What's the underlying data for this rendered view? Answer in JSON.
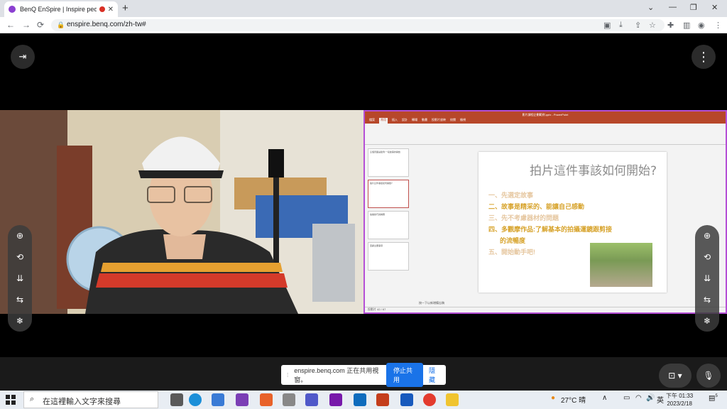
{
  "browser": {
    "tab_title": "BenQ EnSpire | Inspire peo",
    "tab_close": "✕",
    "new_tab": "+",
    "url": "enspire.benq.com/zh-tw#",
    "back": "←",
    "forward": "→",
    "reload": "⟳"
  },
  "meeting": {
    "exit_label": "⇥",
    "more_label": "⋮"
  },
  "ppt": {
    "window_title": "影片課程企劃範例.pptx - PowerPoint",
    "tabs": [
      "檔案",
      "常用",
      "插入",
      "設計",
      "轉場",
      "動畫",
      "投影片放映",
      "校閱",
      "檢視"
    ],
    "active_tab": "常用",
    "thumb1": "這個頁面是範例:一段故事的開始",
    "thumb2": "拍片這件事該如何開始?",
    "thumb3": "拍攝技巧與構圖",
    "thumb4": "回顧主要事項",
    "slide_title": "拍片這件事該如何開始?",
    "items": [
      "一、先選定故事",
      "二、故事是精采的、能讓自己感動",
      "三、先不考慮器材的問題",
      "四、多觀摩作品:了解基本的拍攝運鏡跟剪接",
      "的流暢度",
      "五、開始動手吧!"
    ],
    "notes": "按一下以新增備忘稿",
    "status": "投影片 42 / 67"
  },
  "share_notice": {
    "text": "enspire.benq.com 正在共用視窗。",
    "stop_label": "停止共用",
    "hide_label": "隱藏"
  },
  "taskbar": {
    "search_placeholder": "在這裡輸入文字來搜尋",
    "weather": "27°C 晴",
    "ime": "英",
    "time": "下午 01:33",
    "date": "2023/2/18",
    "notification_count": "5"
  },
  "colors": {
    "accent": "#1a73e8",
    "ppt_red": "#b7472a",
    "share_border": "#b54fd6",
    "slide_highlight": "#d7a32b"
  }
}
